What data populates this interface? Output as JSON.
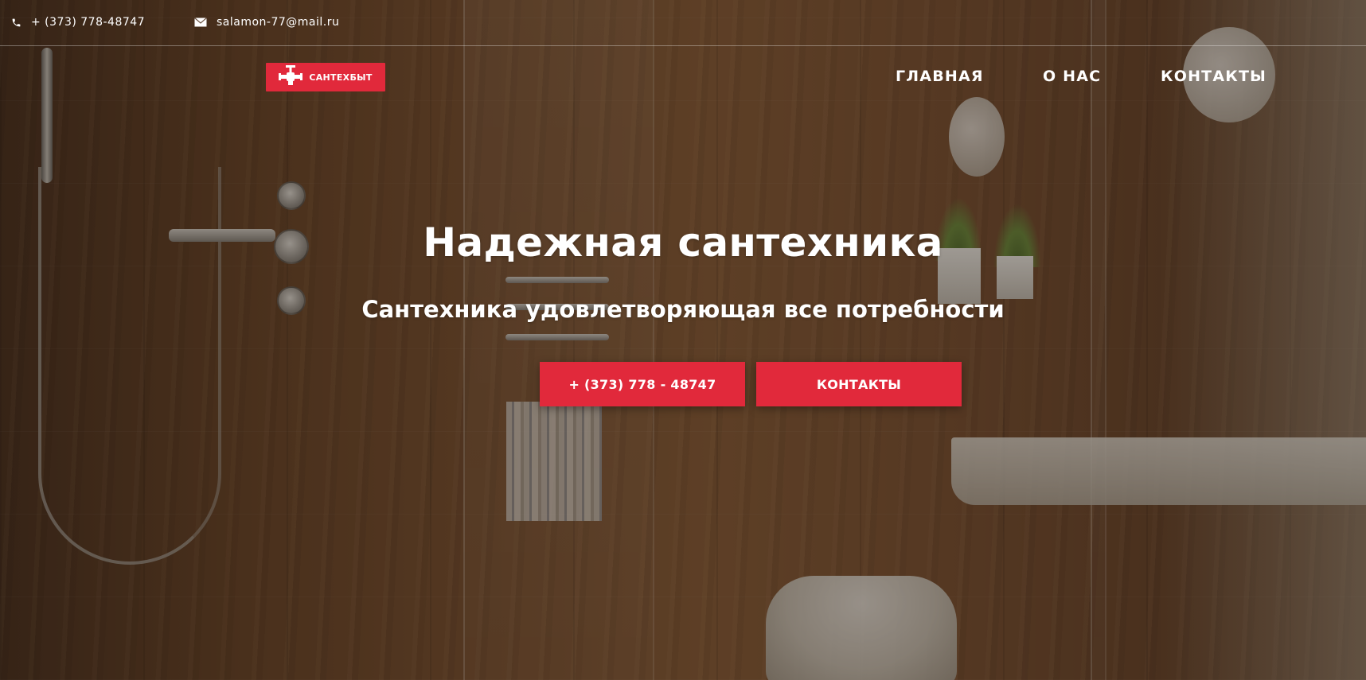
{
  "topbar": {
    "phone": "+ (373) 778-48747",
    "email": "salamon-77@mail.ru",
    "phone_icon": "phone-icon",
    "email_icon": "envelope-icon"
  },
  "logo": {
    "text": "САНТЕХБЫТ",
    "icon": "valve-icon",
    "color": "#e1293b"
  },
  "nav": {
    "items": [
      {
        "label": "ГЛАВНАЯ"
      },
      {
        "label": "О НАС"
      },
      {
        "label": "КОНТАКТЫ"
      }
    ]
  },
  "hero": {
    "title": "Надежная сантехника",
    "subtitle": "Сантехника удовлетворяющая все потребности",
    "buttons": [
      {
        "label": "+ (373) 778 - 48747"
      },
      {
        "label": "КОНТАКТЫ"
      }
    ],
    "accent_color": "#e1293b"
  }
}
